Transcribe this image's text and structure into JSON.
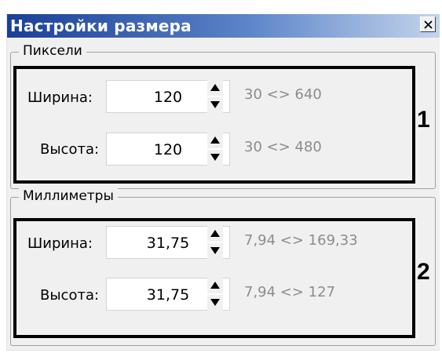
{
  "window": {
    "title": "Настройки размера",
    "close_icon": "close-x-icon"
  },
  "pixels_group": {
    "legend": "Пиксели",
    "marker": "1",
    "width": {
      "label": "Ширина:",
      "value": "120",
      "range": "30 <> 640"
    },
    "height": {
      "label": "Высота:",
      "value": "120",
      "range": "30 <> 480"
    }
  },
  "mm_group": {
    "legend": "Миллиметры",
    "marker": "2",
    "width": {
      "label": "Ширина:",
      "value": "31,75",
      "range": "7,94 <> 169,33"
    },
    "height": {
      "label": "Высота:",
      "value": "31,75",
      "range": "7,94 <> 127"
    }
  },
  "colors": {
    "title_gradient_start": "#1a3f97",
    "title_gradient_end": "#c4d4ec",
    "range_text": "#8c8c8c",
    "highlight_box": "#000000"
  }
}
